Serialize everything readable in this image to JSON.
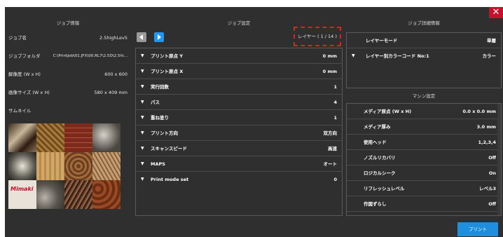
{
  "close_label": "✕",
  "job_info": {
    "title": "ジョブ情報",
    "rows": [
      {
        "label": "ジョブ名",
        "value": "2.5highLev5"
      },
      {
        "label": "ジョブフォルダ",
        "value": "C:\\PrintJob\\01.JFX\\00.RL7\\2.5D\\2.5hi..."
      },
      {
        "label": "解像度 (W x H)",
        "value": "600 x 600"
      },
      {
        "label": "画像サイズ (W x H)",
        "value": "580 x 409 mm"
      }
    ],
    "thumbnail_label": "サムネイル",
    "thumbnail_logo": "Mimaki"
  },
  "job_settings": {
    "title": "ジョブ設定",
    "layer_label": "レイヤー ( 1 / 14 )",
    "rows": [
      {
        "label": "プリント原点 Y",
        "value": "0 mm"
      },
      {
        "label": "プリント原点 X",
        "value": "0 mm"
      },
      {
        "label": "実行回数",
        "value": "1"
      },
      {
        "label": "パス",
        "value": "4"
      },
      {
        "label": "重ね塗り",
        "value": "1"
      },
      {
        "label": "プリント方向",
        "value": "双方向"
      },
      {
        "label": "スキャンスピード",
        "value": "高速"
      },
      {
        "label": "MAPS",
        "value": "オート"
      },
      {
        "label": "Print mode set",
        "value": "0"
      }
    ]
  },
  "job_detail": {
    "title": "ジョブ詳細情報",
    "rows": [
      {
        "label": "レイヤーモード",
        "value": "単層",
        "arrow": ""
      },
      {
        "label": "レイヤー別カラーコード No:1",
        "value": "カラー",
        "arrow": "▼"
      }
    ]
  },
  "machine": {
    "title": "マシン設定",
    "rows": [
      {
        "label": "メディア原点 (W x H)",
        "value": "0.0 x 0.0 mm"
      },
      {
        "label": "メディア厚み",
        "value": "3.0 mm"
      },
      {
        "label": "使用ヘッド",
        "value": "1,2,3,4"
      },
      {
        "label": "ノズルリカバリ",
        "value": "Off"
      },
      {
        "label": "ロジカルシーク",
        "value": "On"
      },
      {
        "label": "リフレッシュレベル",
        "value": "レベル3"
      },
      {
        "label": "作図ずらし",
        "value": "Off"
      }
    ]
  },
  "print_label": "プリント",
  "colors": {
    "accent": "#2196f3",
    "close": "#c8102e",
    "highlight": "#e0201a"
  }
}
